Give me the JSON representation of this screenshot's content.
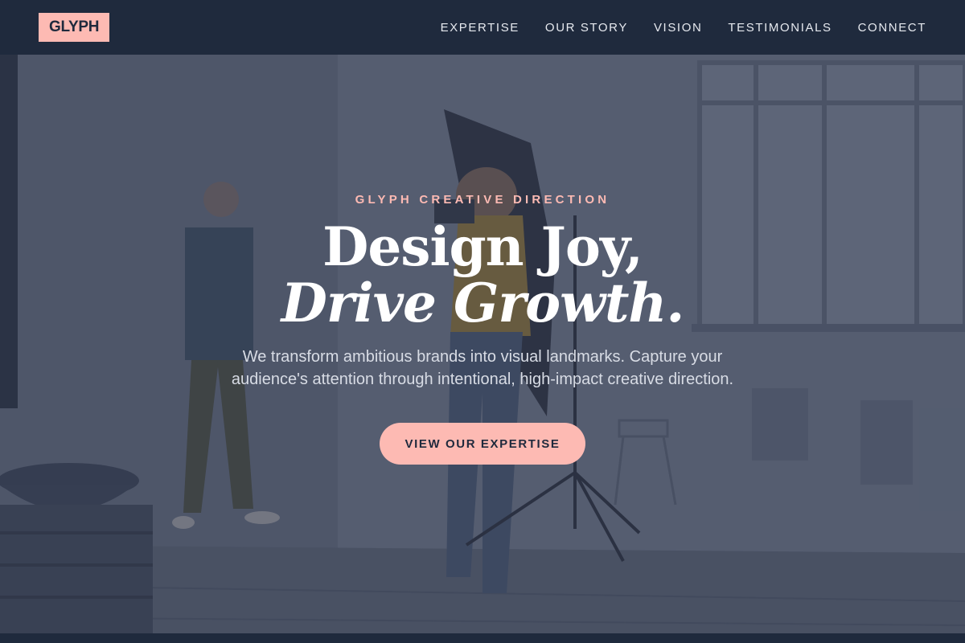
{
  "header": {
    "logo": "GLYPH",
    "nav": [
      {
        "label": "EXPERTISE"
      },
      {
        "label": "OUR STORY"
      },
      {
        "label": "VISION"
      },
      {
        "label": "TESTIMONIALS"
      },
      {
        "label": "CONNECT"
      }
    ]
  },
  "hero": {
    "eyebrow": "GLYPH CREATIVE DIRECTION",
    "headline_line1": "Design Joy,",
    "headline_line2": "Drive Growth.",
    "subtitle": "We transform ambitious brands into visual landmarks. Capture your audience's attention through intentional, high-impact creative direction.",
    "cta_label": "VIEW OUR EXPERTISE"
  },
  "colors": {
    "navy": "#1f2a3d",
    "accent_pink": "#fdbab3",
    "white": "#ffffff"
  }
}
